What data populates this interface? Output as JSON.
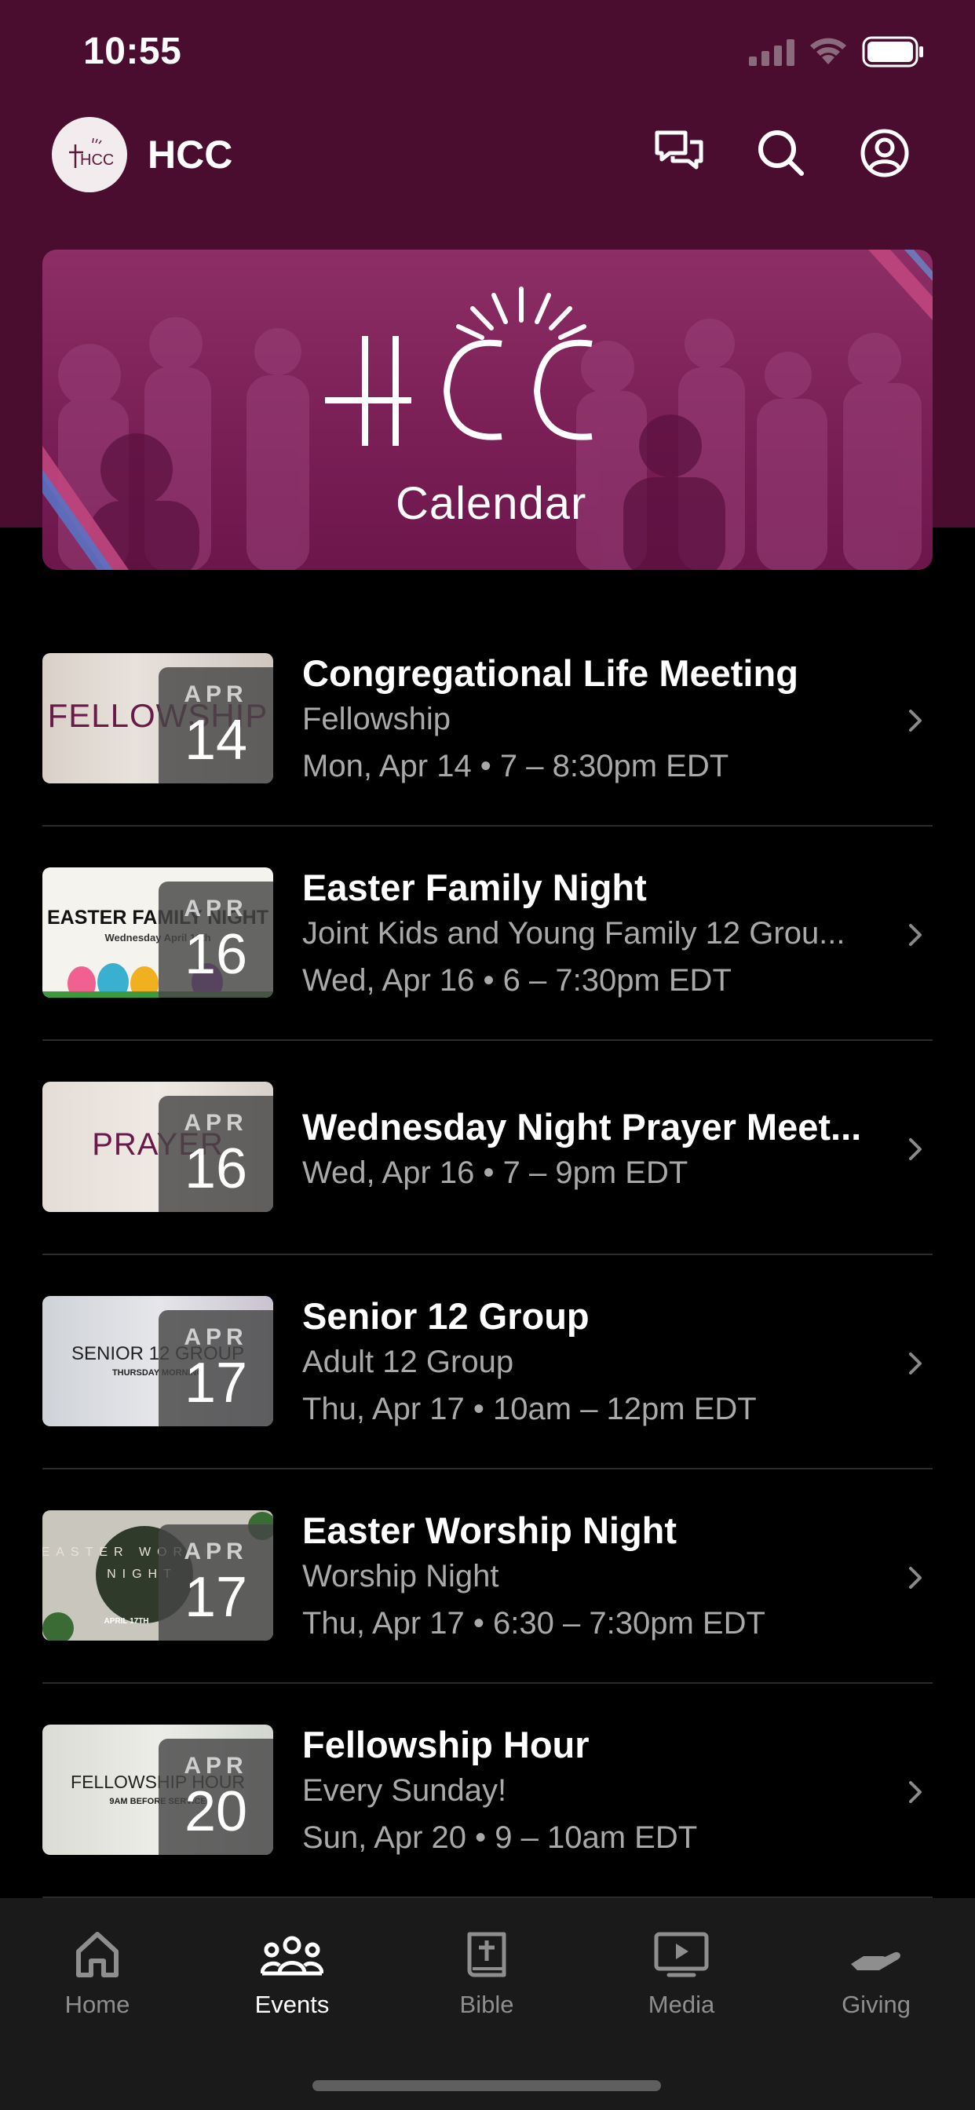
{
  "status_bar": {
    "time": "10:55"
  },
  "header": {
    "app_name": "HCC",
    "logo_text": "HCC",
    "icons": [
      "chat-icon",
      "search-icon",
      "profile-icon"
    ]
  },
  "banner": {
    "logo_text": "HCC",
    "subtitle": "Calendar"
  },
  "events": [
    {
      "title": "Congregational Life Meeting",
      "category": "Fellowship",
      "time": "Mon, Apr 14 • 7 – 8:30pm EDT",
      "month": "APR",
      "day": "14",
      "thumb_text": "FELLOWSHIP",
      "thumb_subtext": ""
    },
    {
      "title": "Easter Family Night",
      "category": "Joint Kids and Young Family 12 Grou...",
      "time": "Wed, Apr 16 • 6 – 7:30pm EDT",
      "month": "APR",
      "day": "16",
      "thumb_text": "EASTER FAMILY NIGHT",
      "thumb_subtext": "Wednesday April 16th"
    },
    {
      "title": "Wednesday Night Prayer Meet...",
      "category": "",
      "time": "Wed, Apr 16 • 7 – 9pm EDT",
      "month": "APR",
      "day": "16",
      "thumb_text": "PRAYER",
      "thumb_subtext": ""
    },
    {
      "title": "Senior 12 Group",
      "category": "Adult 12 Group",
      "time": "Thu, Apr 17 • 10am – 12pm EDT",
      "month": "APR",
      "day": "17",
      "thumb_text": "SENIOR 12 GROUP",
      "thumb_subtext": "THURSDAY MORNING"
    },
    {
      "title": "Easter Worship Night",
      "category": "Worship Night",
      "time": "Thu, Apr 17 • 6:30 – 7:30pm EDT",
      "month": "APR",
      "day": "17",
      "thumb_text": "EASTER WORSHIP NIGHT",
      "thumb_subtext": "APRIL 17TH"
    },
    {
      "title": "Fellowship Hour",
      "category": "Every Sunday!",
      "time": "Sun, Apr 20 • 9 – 10am EDT",
      "month": "APR",
      "day": "20",
      "thumb_text": "FELLOWSHIP HOUR",
      "thumb_subtext": "9AM BEFORE SERVICE"
    }
  ],
  "tabs": [
    {
      "label": "Home",
      "icon": "home-icon",
      "active": false
    },
    {
      "label": "Events",
      "icon": "people-icon",
      "active": true
    },
    {
      "label": "Bible",
      "icon": "bible-icon",
      "active": false
    },
    {
      "label": "Media",
      "icon": "media-icon",
      "active": false
    },
    {
      "label": "Giving",
      "icon": "giving-icon",
      "active": false
    }
  ],
  "colors": {
    "header_bg": "#4a0d30",
    "banner_bg": "#7b1f57",
    "accent": "#7a1d52",
    "tab_inactive": "#8e8e8e"
  }
}
